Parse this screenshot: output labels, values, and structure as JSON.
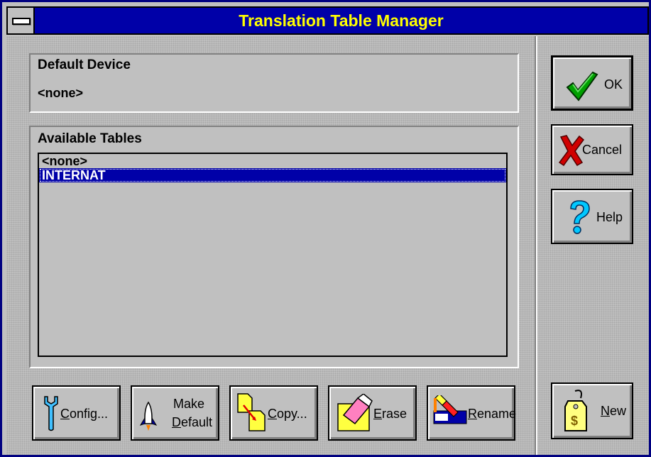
{
  "window": {
    "title": "Translation Table Manager"
  },
  "default_device": {
    "label": "Default Device",
    "value": "<none>"
  },
  "available_tables": {
    "label": "Available Tables",
    "items": [
      {
        "label": "<none>",
        "selected": false
      },
      {
        "label": "INTERNAT",
        "selected": true
      }
    ]
  },
  "side_buttons": {
    "ok": {
      "label": "OK",
      "icon": "checkmark-icon"
    },
    "cancel": {
      "label": "Cancel",
      "icon": "red-x-icon"
    },
    "help": {
      "label": "Help",
      "icon": "question-mark-icon"
    },
    "new": {
      "accel": "N",
      "rest": "ew",
      "icon": "price-tag-icon"
    }
  },
  "bottom_buttons": {
    "config": {
      "accel": "C",
      "rest": "onfig...",
      "icon": "wrench-icon"
    },
    "make_default": {
      "line1": "Make",
      "accel": "D",
      "rest": "efault",
      "icon": "rocket-icon"
    },
    "copy": {
      "accel": "C",
      "rest": "opy...",
      "icon": "copy-documents-icon"
    },
    "erase": {
      "accel": "E",
      "rest": "rase",
      "icon": "eraser-icon"
    },
    "rename": {
      "accel": "R",
      "rest": "ename",
      "icon": "rename-icon"
    }
  },
  "colors": {
    "title_bg": "#0000a8",
    "title_text": "#ffff00",
    "selection": "#0000a8",
    "face": "#c0c0c0"
  }
}
